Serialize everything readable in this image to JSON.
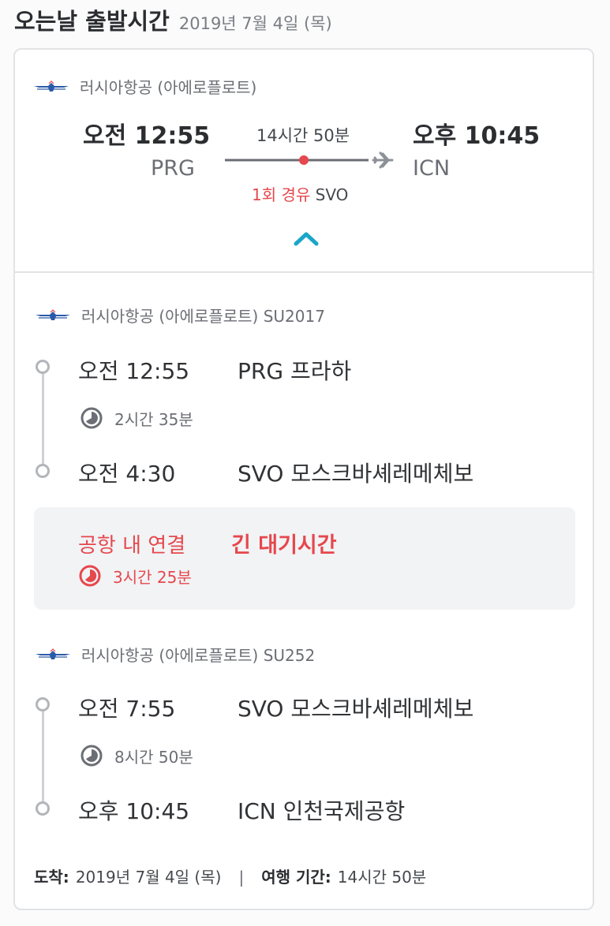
{
  "header": {
    "title": "오는날 출발시간",
    "date": "2019년 7월 4일 (목)"
  },
  "summary": {
    "airline": "러시아항공 (아에로플로트)",
    "departure": {
      "time": "오전 12:55",
      "code": "PRG"
    },
    "arrival": {
      "time": "오후 10:45",
      "code": "ICN"
    },
    "duration": "14시간 50분",
    "stops_label": "1회 경유",
    "stop_code": "SVO"
  },
  "segments": [
    {
      "airline": "러시아항공 (아에로플로트) SU2017",
      "dep_time": "오전 12:55",
      "dep_airport": "PRG 프라하",
      "duration": "2시간 35분",
      "arr_time": "오전 4:30",
      "arr_airport": "SVO 모스크바셰레메체보"
    },
    {
      "airline": "러시아항공 (아에로플로트) SU252",
      "dep_time": "오전 7:55",
      "dep_airport": "SVO 모스크바셰레메체보",
      "duration": "8시간 50분",
      "arr_time": "오후 10:45",
      "arr_airport": "ICN 인천국제공항"
    }
  ],
  "layover": {
    "label": "공항 내 연결",
    "warning": "긴 대기시간",
    "duration": "3시간 25분"
  },
  "footer": {
    "arrival_label": "도착:",
    "arrival_value": "2019년 7월 4일 (목)",
    "separator": "|",
    "trip_label": "여행 기간:",
    "trip_value": "14시간 50분"
  },
  "colors": {
    "accent": "#1aa6c9",
    "alert": "#e5484d",
    "logo": "#2b5aa8"
  },
  "icons": [
    "aeroflot-logo",
    "plane-icon",
    "chevron-up-icon",
    "clock-icon"
  ]
}
